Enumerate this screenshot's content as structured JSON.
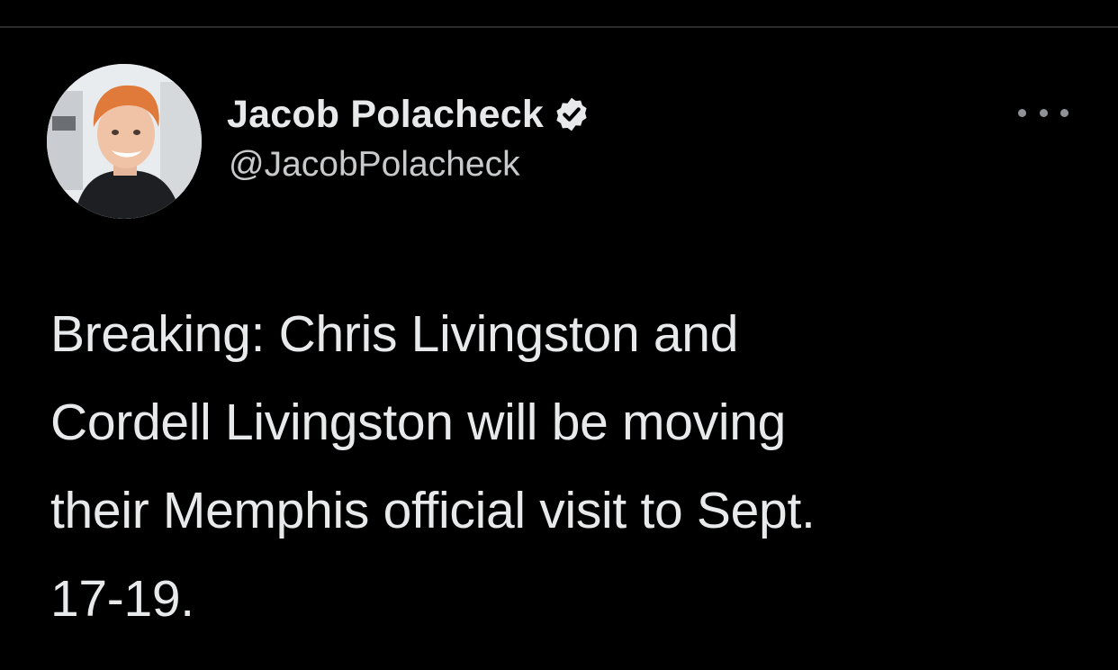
{
  "tweet": {
    "author": {
      "display_name": "Jacob Polacheck",
      "handle": "@JacobPolacheck",
      "verified": true,
      "avatar": "profile-photo-avatar"
    },
    "text_lines": [
      "Breaking: Chris Livingston and",
      "Cordell Livingston will be moving",
      "their Memphis official visit to Sept.",
      "17-19."
    ],
    "icons": {
      "verified": "verified-badge-icon",
      "more": "more-options-icon"
    }
  },
  "colors": {
    "background": "#000000",
    "text_primary": "#e7e9ea",
    "text_secondary": "#c8cacc",
    "icon_muted": "#8f9397",
    "divider": "#2a2a2a"
  }
}
